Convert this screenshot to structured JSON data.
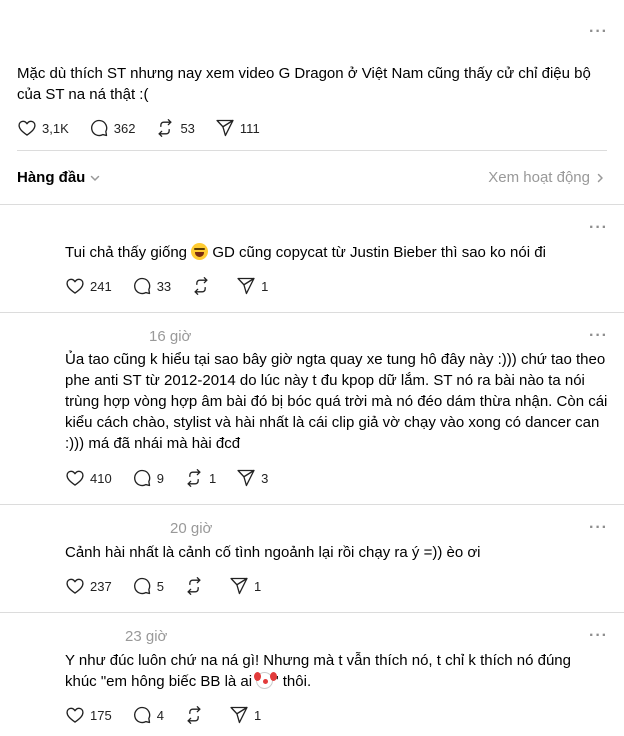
{
  "main_post": {
    "text": "Mặc dù thích ST nhưng nay xem video G Dragon ở Việt Nam cũng thấy cử chỉ điệu bộ của ST na ná thật :(",
    "likes": "3,1K",
    "replies": "362",
    "reposts": "53",
    "shares": "111"
  },
  "sort_bar": {
    "sort_label": "Hàng đầu",
    "activity_link": "Xem hoạt động"
  },
  "comments": [
    {
      "time": "",
      "text_before": "Tui chả thấy giống ",
      "text_after": " GD cũng copycat từ Justin Bieber thì sao ko nói đi",
      "likes": "241",
      "replies": "33",
      "reposts": "",
      "shares": "1"
    },
    {
      "time": "16 giờ",
      "text": "Ủa tao cũng k hiểu tại sao bây giờ ngta quay xe tung hô đây này :))) chứ tao theo phe anti ST từ 2012-2014 do lúc này t đu kpop dữ lắm. ST nó ra bài nào ta nói trùng hợp vòng hợp âm bài đó bị bóc quá trời mà nó đéo dám thừa nhận. Còn cái kiểu cách chào, stylist và hài nhất là cái clip giả vờ chạy vào xong có dancer can :))) má đã nhái mà hài đcđ",
      "likes": "410",
      "replies": "9",
      "reposts": "1",
      "shares": "3"
    },
    {
      "time": "20 giờ",
      "text": "Cảnh hài nhất là cảnh cố tình ngoảnh lại rồi chạy ra ý =)) èo ơi",
      "likes": "237",
      "replies": "5",
      "reposts": "",
      "shares": "1"
    },
    {
      "time": "23 giờ",
      "text_before": "Y như đúc luôn chứ na ná gì! Nhưng mà t vẫn thích nó, t chỉ k thích nó đúng khúc \"em hông biếc BB là ai ",
      "text_after": "\" thôi.",
      "likes": "175",
      "replies": "4",
      "reposts": "",
      "shares": "1"
    }
  ],
  "icons": {
    "more": "more-horizontal-icon",
    "like": "heart-icon",
    "reply": "comment-icon",
    "repost": "repost-icon",
    "share": "send-icon",
    "chevron_down": "chevron-down-icon",
    "chevron_right": "chevron-right-icon"
  }
}
